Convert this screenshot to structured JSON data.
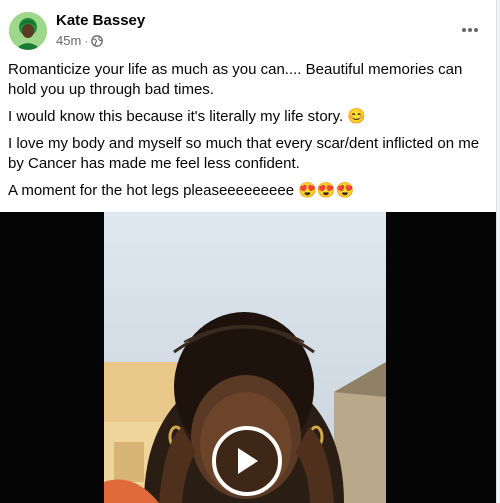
{
  "post": {
    "author_name": "Kate Bassey",
    "timestamp": "45m",
    "separator": "·",
    "audience_icon": "globe-icon",
    "more_icon": "more-options-icon",
    "paragraphs": [
      "Romanticize your life as much as you can.... Beautiful memories can hold you up through bad times.",
      "I would know this because it's literally my life story. 😊",
      "I love my body and myself so much that every scar/dent inflicted on me by Cancer has made me feel less confident.",
      "A moment for the hot legs pleaseeeeeeeee 😍😍😍"
    ]
  },
  "video": {
    "play_icon": "play-icon",
    "accent": "#ffffff"
  }
}
